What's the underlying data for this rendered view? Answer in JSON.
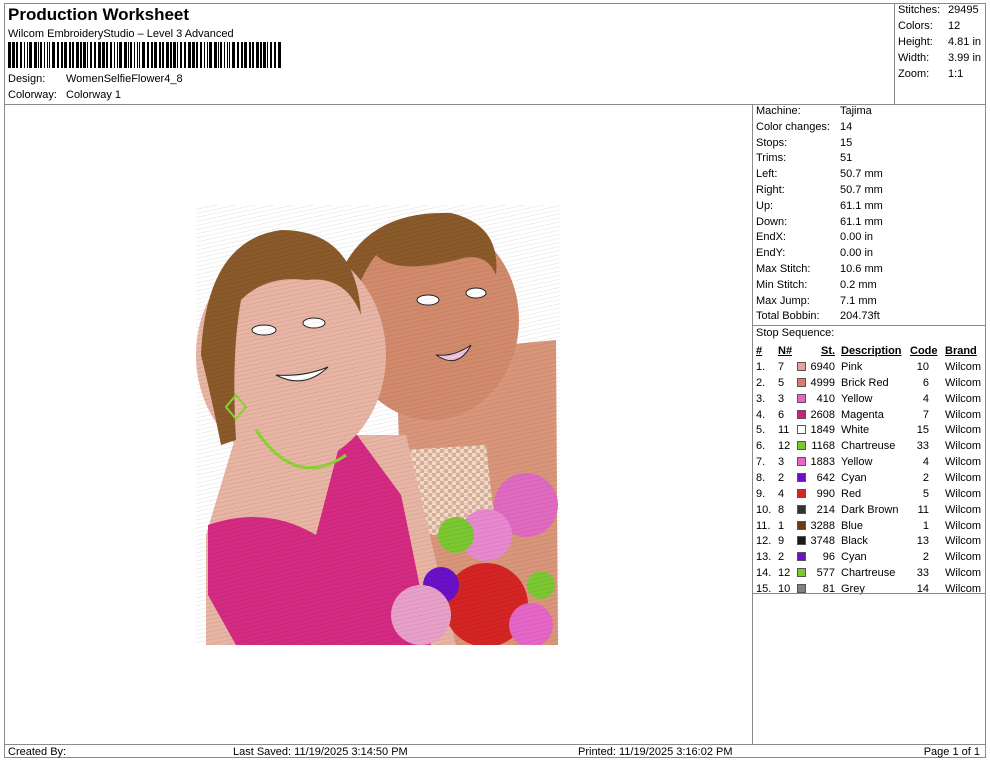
{
  "header": {
    "title": "Production Worksheet",
    "subtitle": "Wilcom EmbroideryStudio – Level 3 Advanced",
    "design_label": "Design:",
    "design_value": "WomenSelfieFlower4_8",
    "colorway_label": "Colorway:",
    "colorway_value": "Colorway 1"
  },
  "summary": [
    {
      "label": "Stitches:",
      "value": "29495"
    },
    {
      "label": "Colors:",
      "value": "12"
    },
    {
      "label": "Height:",
      "value": "4.81 in"
    },
    {
      "label": "Width:",
      "value": "3.99 in"
    },
    {
      "label": "Zoom:",
      "value": "1:1"
    }
  ],
  "machine_info": [
    {
      "label": "Machine:",
      "value": "Tajima"
    },
    {
      "label": "Color changes:",
      "value": "14"
    },
    {
      "label": "Stops:",
      "value": "15"
    },
    {
      "label": "Trims:",
      "value": "51"
    },
    {
      "label": "Left:",
      "value": "50.7 mm"
    },
    {
      "label": "Right:",
      "value": "50.7 mm"
    },
    {
      "label": "Up:",
      "value": "61.1 mm"
    },
    {
      "label": "Down:",
      "value": "61.1 mm"
    },
    {
      "label": "EndX:",
      "value": "0.00 in"
    },
    {
      "label": "EndY:",
      "value": "0.00 in"
    },
    {
      "label": "Max Stitch:",
      "value": "10.6 mm"
    },
    {
      "label": "Min Stitch:",
      "value": "0.2 mm"
    },
    {
      "label": "Max Jump:",
      "value": "7.1 mm"
    },
    {
      "label": "Total Bobbin:",
      "value": "204.73ft"
    }
  ],
  "stop_sequence": {
    "title": "Stop Sequence:",
    "headers": {
      "num": "#",
      "n": "N#",
      "st": "St.",
      "description": "Description",
      "code": "Code",
      "brand": "Brand"
    },
    "rows": [
      {
        "num": "1.",
        "n": "7",
        "color": "#e8a0a0",
        "st": "6940",
        "description": "Pink",
        "code": "10",
        "brand": "Wilcom"
      },
      {
        "num": "2.",
        "n": "5",
        "color": "#e07a6e",
        "st": "4999",
        "description": "Brick Red",
        "code": "6",
        "brand": "Wilcom"
      },
      {
        "num": "3.",
        "n": "3",
        "color": "#e666c8",
        "st": "410",
        "description": "Yellow",
        "code": "4",
        "brand": "Wilcom"
      },
      {
        "num": "4.",
        "n": "6",
        "color": "#d11e7e",
        "st": "2608",
        "description": "Magenta",
        "code": "7",
        "brand": "Wilcom"
      },
      {
        "num": "5.",
        "n": "11",
        "color": "#ffffff",
        "st": "1849",
        "description": "White",
        "code": "15",
        "brand": "Wilcom"
      },
      {
        "num": "6.",
        "n": "12",
        "color": "#7cc832",
        "st": "1168",
        "description": "Chartreuse",
        "code": "33",
        "brand": "Wilcom"
      },
      {
        "num": "7.",
        "n": "3",
        "color": "#e666c8",
        "st": "1883",
        "description": "Yellow",
        "code": "4",
        "brand": "Wilcom"
      },
      {
        "num": "8.",
        "n": "2",
        "color": "#6a10c8",
        "st": "642",
        "description": "Cyan",
        "code": "2",
        "brand": "Wilcom"
      },
      {
        "num": "9.",
        "n": "4",
        "color": "#d42424",
        "st": "990",
        "description": "Red",
        "code": "5",
        "brand": "Wilcom"
      },
      {
        "num": "10.",
        "n": "8",
        "color": "#333333",
        "st": "214",
        "description": "Dark Brown",
        "code": "11",
        "brand": "Wilcom"
      },
      {
        "num": "11.",
        "n": "1",
        "color": "#6b3a12",
        "st": "3288",
        "description": "Blue",
        "code": "1",
        "brand": "Wilcom"
      },
      {
        "num": "12.",
        "n": "9",
        "color": "#1a1a1a",
        "st": "3748",
        "description": "Black",
        "code": "13",
        "brand": "Wilcom"
      },
      {
        "num": "13.",
        "n": "2",
        "color": "#6a10c8",
        "st": "96",
        "description": "Cyan",
        "code": "2",
        "brand": "Wilcom"
      },
      {
        "num": "14.",
        "n": "12",
        "color": "#7cc832",
        "st": "577",
        "description": "Chartreuse",
        "code": "33",
        "brand": "Wilcom"
      },
      {
        "num": "15.",
        "n": "10",
        "color": "#808080",
        "st": "81",
        "description": "Grey",
        "code": "14",
        "brand": "Wilcom"
      }
    ]
  },
  "footer": {
    "created_by": "Created By:",
    "last_saved": "Last Saved: 11/19/2025 3:14:50 PM",
    "printed": "Printed: 11/19/2025 3:16:02 PM",
    "page": "Page 1 of 1"
  },
  "colors": {
    "border": "#8a8a8a",
    "skin_left": "#e8b4a4",
    "skin_right": "#d9967a",
    "hair": "#8a5a2a",
    "dress": "#d42a82",
    "necklace": "#8ad432"
  }
}
